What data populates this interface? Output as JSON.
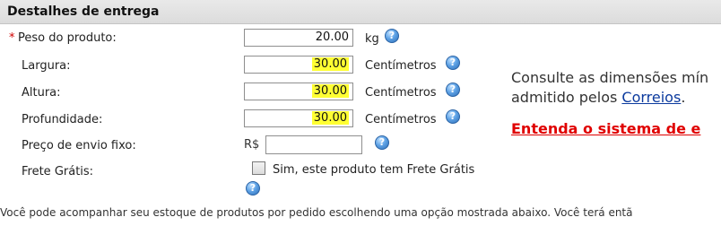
{
  "header": {
    "title": "Destalhes de entrega"
  },
  "fields": {
    "weight": {
      "required_mark": "*",
      "label": "Peso do produto:",
      "value": "20.00",
      "unit": "kg"
    },
    "width": {
      "label": "Largura:",
      "value": "30.00",
      "unit": "Centímetros"
    },
    "height": {
      "label": "Altura:",
      "value": "30.00",
      "unit": "Centímetros"
    },
    "depth": {
      "label": "Profundidade:",
      "value": "30.00",
      "unit": "Centímetros"
    },
    "fixed_price": {
      "label": "Preço de envio fixo:",
      "currency": "R$",
      "value": ""
    },
    "free_shipping": {
      "label": "Frete Grátis:",
      "checkbox_label": "Sim, este produto tem Frete Grátis",
      "checked": false
    }
  },
  "help_icon_glyph": "?",
  "side_info": {
    "line1": "Consulte as dimensões mín",
    "line2_prefix": "admitido pelos ",
    "link": "Correios",
    "line2_suffix": ".",
    "entenda": "Entenda o sistema de e"
  },
  "footer": {
    "text": "Você pode acompanhar seu estoque de produtos por pedido escolhendo uma opção mostrada abaixo. Você terá entã"
  },
  "colors": {
    "highlight": "#ffff33",
    "link": "#0b3a9e",
    "alert": "#e00000",
    "help_icon": "#3f86d6"
  }
}
